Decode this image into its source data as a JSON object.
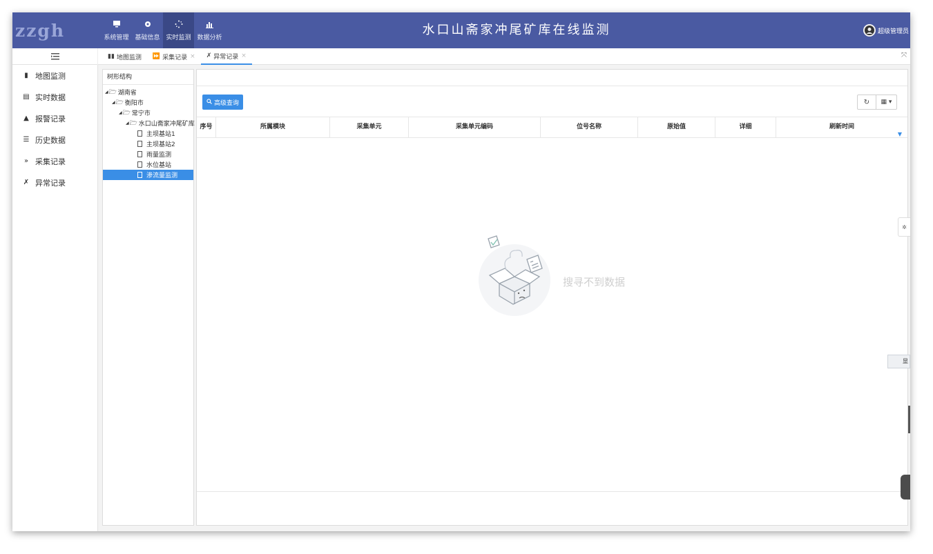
{
  "header": {
    "logo": "zzgh",
    "title": "水口山斋家冲尾矿库在线监测",
    "user": "超级管理员",
    "nav": [
      {
        "label": "系统管理",
        "icon": "monitor-icon"
      },
      {
        "label": "基础信息",
        "icon": "gear-icon"
      },
      {
        "label": "实时监测",
        "icon": "spinner-icon"
      },
      {
        "label": "数据分析",
        "icon": "bar-chart-icon"
      }
    ],
    "colors": {
      "bar": "#4a5aa2",
      "active": "#3a4886",
      "accent": "#3a8ee6"
    }
  },
  "tabs": [
    {
      "label": "地图监测",
      "icon": "map-icon"
    },
    {
      "label": "采集记录",
      "icon": "forward-icon"
    },
    {
      "label": "异常记录",
      "icon": "alert-icon"
    }
  ],
  "sidebar": {
    "items": [
      {
        "label": "地图监测",
        "icon": "map-icon"
      },
      {
        "label": "实时数据",
        "icon": "file-icon"
      },
      {
        "label": "报警记录",
        "icon": "bell-icon"
      },
      {
        "label": "历史数据",
        "icon": "list-icon"
      },
      {
        "label": "采集记录",
        "icon": "forward-icon"
      },
      {
        "label": "异常记录",
        "icon": "alert-icon"
      }
    ]
  },
  "tree": {
    "header": "树形结构",
    "nodes": [
      {
        "label": "湖南省"
      },
      {
        "label": "衡阳市"
      },
      {
        "label": "常宁市"
      },
      {
        "label": "水口山斋家冲尾矿库"
      },
      {
        "label": "主坝基站1"
      },
      {
        "label": "主坝基站2"
      },
      {
        "label": "雨量监测"
      },
      {
        "label": "水位基站"
      },
      {
        "label": "渗流量监测"
      }
    ]
  },
  "main": {
    "advanced_search": "高级查询",
    "columns": [
      "序号",
      "所属模块",
      "采集单元",
      "采集单元编码",
      "位号名称",
      "原始值",
      "详细",
      "刷新时间"
    ],
    "empty_text": "搜寻不到数据",
    "side_tab_label": "显"
  }
}
